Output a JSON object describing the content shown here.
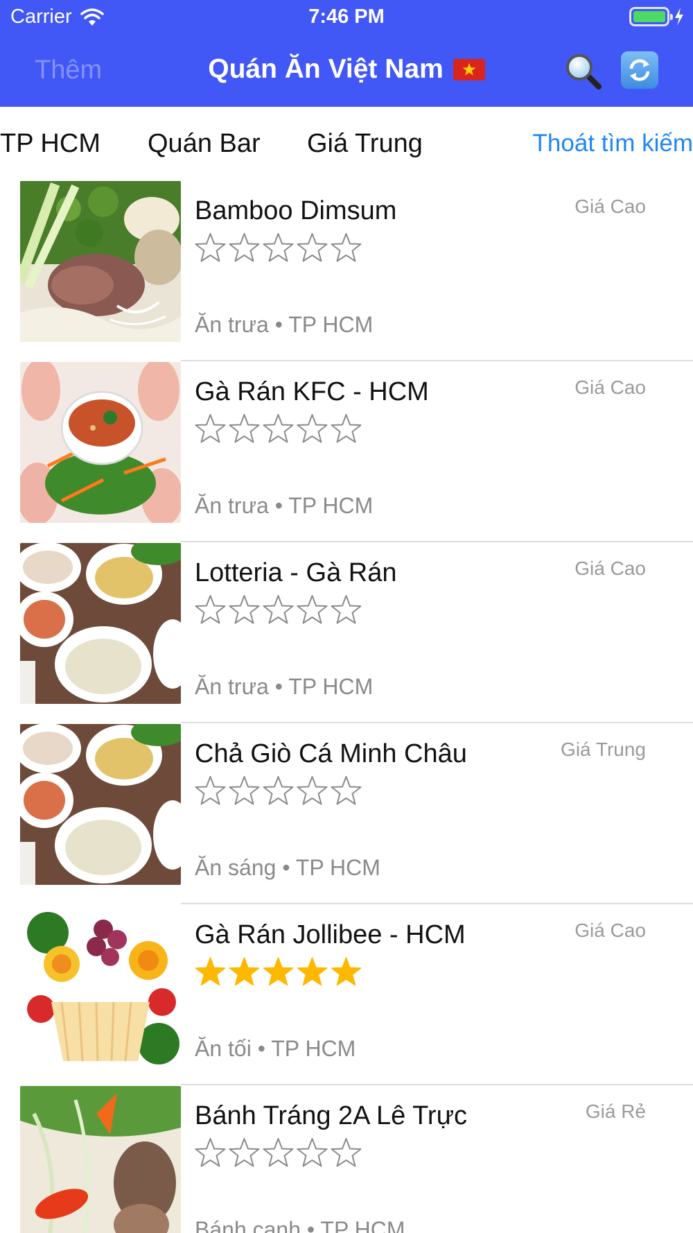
{
  "status_bar": {
    "carrier": "Carrier",
    "time": "7:46 PM"
  },
  "nav": {
    "left_button": "Thêm",
    "title": "Quán Ăn Việt Nam"
  },
  "filters": {
    "city": "TP HCM",
    "type": "Quán Bar",
    "price": "Giá Trung",
    "exit_search": "Thoát tìm kiếm"
  },
  "colors": {
    "nav_bg": "#4157F6",
    "link": "#1E86F6",
    "star_filled": "#FFB800",
    "star_empty_outline": "#8a8a8a"
  },
  "restaurants": [
    {
      "name": "Bamboo Dimsum",
      "price": "Giá Cao",
      "rating": 0,
      "meal": "Ăn trưa",
      "city": "TP HCM",
      "meta": "Ăn trưa • TP HCM",
      "photo": "pho-noodle-soup"
    },
    {
      "name": "Gà Rán KFC - HCM",
      "price": "Giá Cao",
      "rating": 0,
      "meal": "Ăn trưa",
      "city": "TP HCM",
      "meta": "Ăn trưa • TP HCM",
      "photo": "spring-rolls-dip"
    },
    {
      "name": "Lotteria - Gà Rán",
      "price": "Giá Cao",
      "rating": 0,
      "meal": "Ăn trưa",
      "city": "TP HCM",
      "meta": "Ăn trưa • TP HCM",
      "photo": "plates-spread"
    },
    {
      "name": "Chả Giò Cá Minh Châu",
      "price": "Giá Trung",
      "rating": 0,
      "meal": "Ăn sáng",
      "city": "TP HCM",
      "meta": "Ăn sáng • TP HCM",
      "photo": "plates-spread"
    },
    {
      "name": "Gà Rán Jollibee - HCM",
      "price": "Giá Cao",
      "rating": 5,
      "meal": "Ăn tối",
      "city": "TP HCM",
      "meta": "Ăn tối • TP HCM",
      "photo": "fruit-carving"
    },
    {
      "name": "Bánh Tráng 2A Lê Trực",
      "price": "Giá Rẻ",
      "rating": 0,
      "meal": "Bánh canh",
      "city": "TP HCM",
      "meta": "Bánh canh • TP HCM",
      "photo": "herb-salad"
    }
  ]
}
